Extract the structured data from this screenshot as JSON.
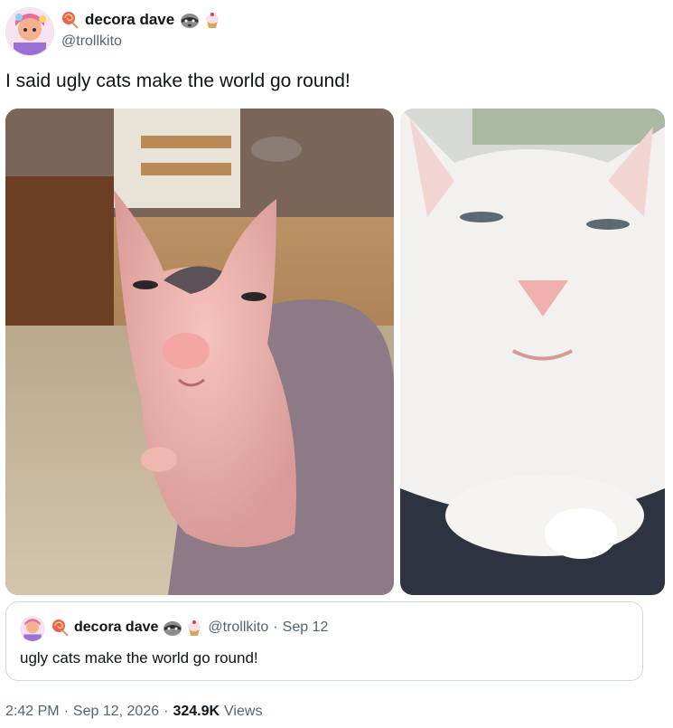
{
  "author": {
    "display_name": "decora dave",
    "handle": "@trollkito",
    "emoji_prefix": "lollipop-emoji",
    "emoji_suffix": [
      "raccoon-emoji",
      "cupcake-emoji"
    ]
  },
  "tweet": {
    "text": "I said ugly cats make the world go round!"
  },
  "media": [
    {
      "description_icon": "sphynx-cat-photo"
    },
    {
      "description_icon": "white-cat-photo"
    }
  ],
  "quoted": {
    "display_name": "decora dave",
    "handle": "@trollkito",
    "dot": "·",
    "date": "Sep 12",
    "text": "ugly cats make the world go round!"
  },
  "meta": {
    "time": "2:42 PM",
    "sep1": "·",
    "date": "Sep 12, 2026",
    "sep2": "·",
    "views_count": "324.9K",
    "views_label": "Views"
  },
  "colors": {
    "text_primary": "#0f1419",
    "text_secondary": "#536471",
    "border": "#cfd9de"
  }
}
